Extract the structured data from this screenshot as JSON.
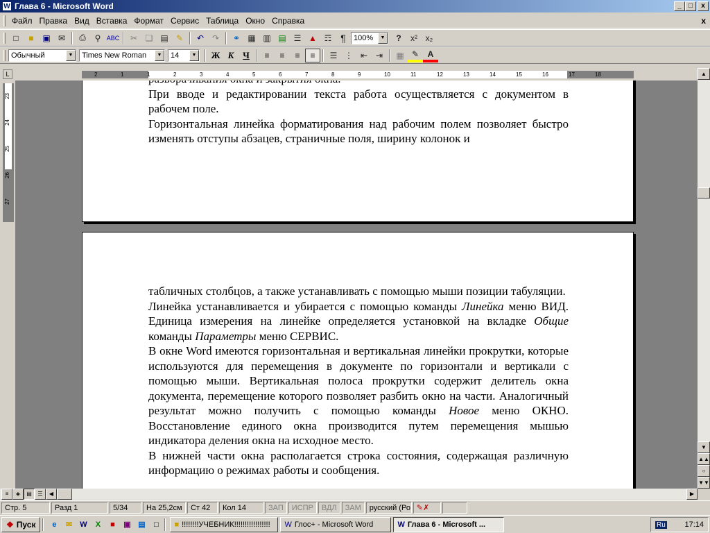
{
  "window": {
    "title": "Глава 6 - Microsoft Word",
    "app_icon_letter": "W",
    "controls": {
      "minimize": "_",
      "maximize": "□",
      "close": "x"
    }
  },
  "menubar": {
    "items": [
      "Файл",
      "Правка",
      "Вид",
      "Вставка",
      "Формат",
      "Сервис",
      "Таблица",
      "Окно",
      "Справка"
    ],
    "doc_close": "x"
  },
  "toolbar_standard": {
    "zoom": "100%",
    "superscript": "x²",
    "subscript": "x₂"
  },
  "toolbar_format": {
    "style": "Обычный",
    "font": "Times New Roman",
    "size": "14",
    "bold": "Ж",
    "italic": "К",
    "underline": "Ч",
    "highlight_color": "#ffff00",
    "font_color": "#ff0000"
  },
  "ruler": {
    "horizontal_ticks": [
      "2",
      "1",
      "1",
      "2",
      "3",
      "4",
      "5",
      "6",
      "7",
      "8",
      "9",
      "10",
      "11",
      "12",
      "13",
      "14",
      "15",
      "16",
      "17",
      "18"
    ],
    "vertical_ticks": [
      "23",
      "24",
      "25",
      "26",
      "27"
    ]
  },
  "document": {
    "page1_lines": [
      {
        "text": "разворачивания окна и закрытия окна."
      },
      {
        "text": "При вводе и редактировании текста работа осуществляется с документом в рабочем поле."
      },
      {
        "text": "Горизонтальная линейка форматирования над рабочим полем позволяет быстро изменять отступы абзацев, страничные поля, ширину колонок и"
      }
    ],
    "page2": {
      "p1": "табличных столбцов, а также устанавливать с помощью мыши позиции табуляции.",
      "p2_a": "Линейка устанавливается и убирается с помощью команды ",
      "p2_i1": "Линейка",
      "p2_b": " меню ВИД. Единица измерения на линейке определяется установкой на вкладке ",
      "p2_i2": "Общие",
      "p2_c": " команды ",
      "p2_i3": "Параметры",
      "p2_d": " меню СЕРВИС.",
      "p3_a": "В окне Word имеются горизонтальная и вертикальная линейки прокрутки, которые используются для перемещения в документе по горизонтали и вертикали с помощью мыши. Вертикальная полоса прокрутки содержит делитель окна документа, перемещение которого позволяет разбить окно на части. Аналогичный результат можно получить с помощью команды ",
      "p3_i": "Новое",
      "p3_b": " меню ОКНО. Восстановление единого окна производится путем перемещения мышью индикатора деления окна на исходное место.",
      "p4": "В нижней части окна располагается строка состояния, содержащая различную информацию о режимах работы и сообщения."
    }
  },
  "statusbar": {
    "page": "Стр. 5",
    "section": "Разд 1",
    "pages": "5/34",
    "at": "На 25,2см",
    "line": "Ст 42",
    "col": "Кол 14",
    "rec": "ЗАП",
    "trk": "ИСПР",
    "ext": "ВДЛ",
    "ovr": "ЗАМ",
    "lang": "русский (Ро"
  },
  "taskbar": {
    "start": "Пуск",
    "tasks": [
      {
        "label": "!!!!!!!!УЧЕБНИК!!!!!!!!!!!!!!!!!",
        "active": false
      },
      {
        "label": "Глос+ - Microsoft Word",
        "active": false
      },
      {
        "label": "Глава 6 - Microsoft ...",
        "active": true
      }
    ],
    "lang": "Ru",
    "clock": "17:14"
  }
}
